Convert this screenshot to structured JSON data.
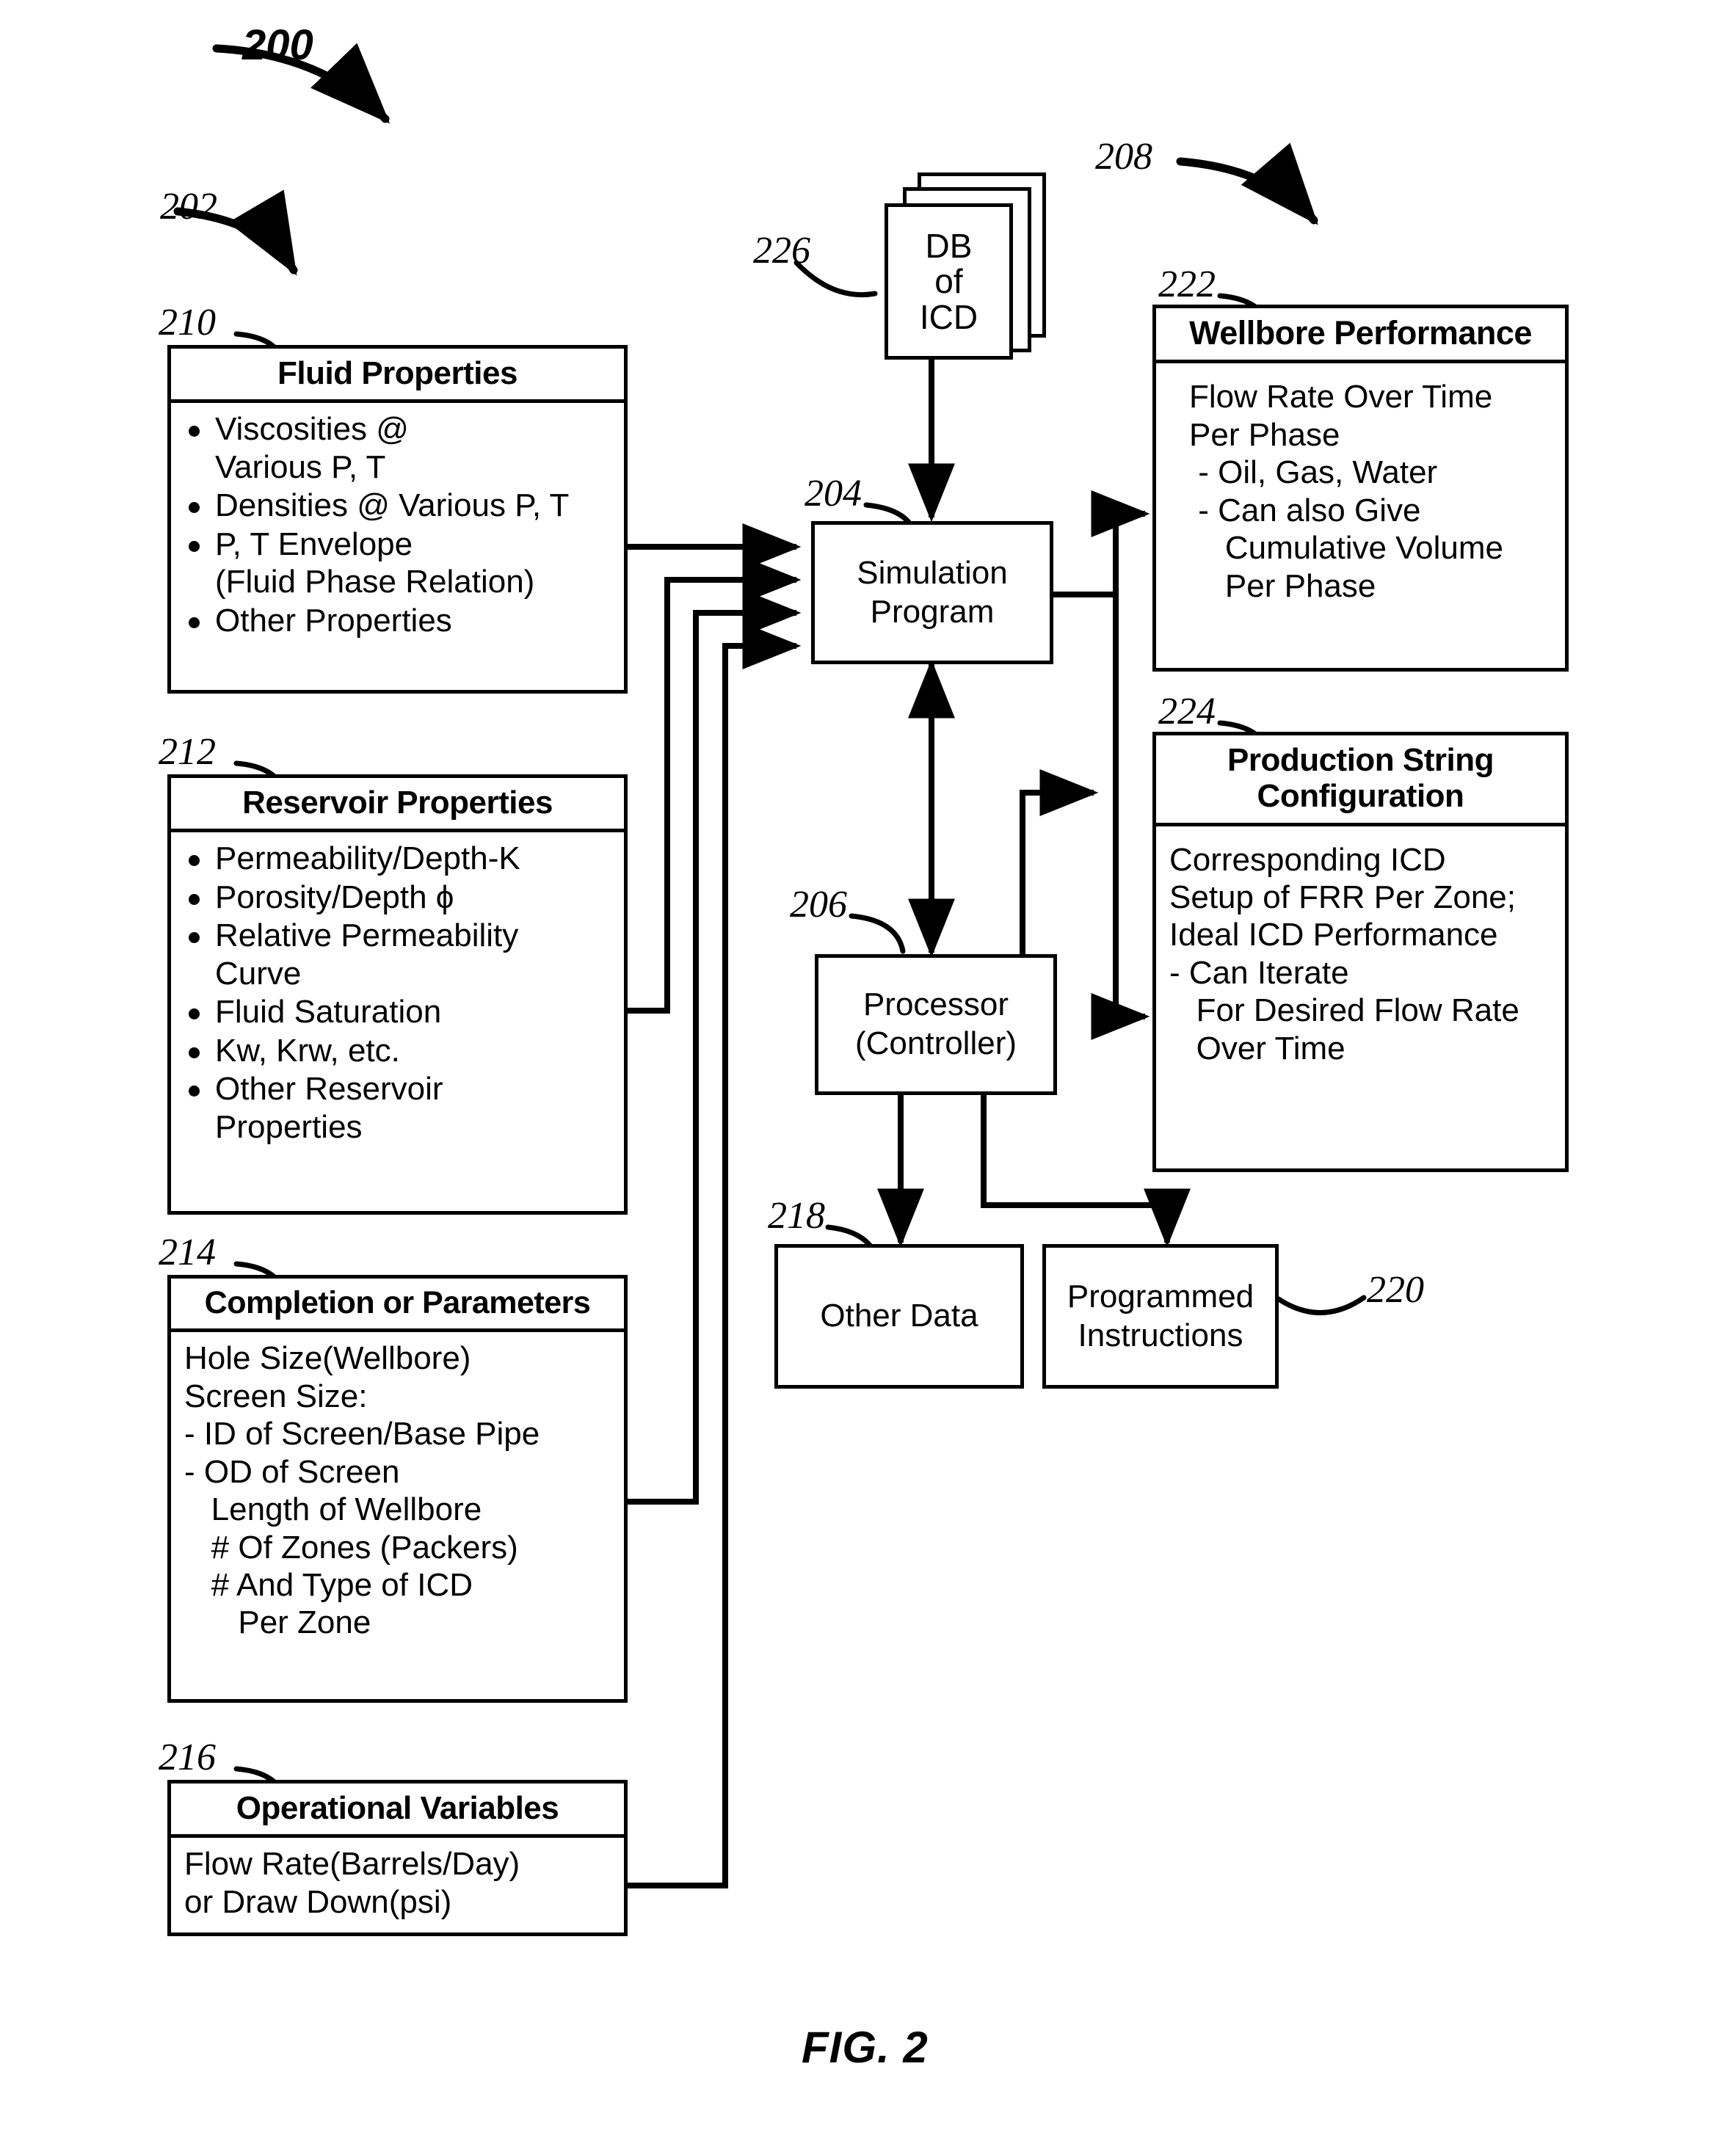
{
  "figure": {
    "caption": "FIG. 2",
    "system_ref": "200",
    "inputs_group_ref": "202",
    "outputs_group_ref": "208"
  },
  "boxes": {
    "fluid_properties": {
      "ref": "210",
      "title": "Fluid Properties",
      "bullets": [
        "Viscosities @\nVarious P, T",
        "Densities @ Various P, T",
        "P, T Envelope\n (Fluid Phase Relation)",
        "Other Properties"
      ]
    },
    "reservoir_properties": {
      "ref": "212",
      "title": "Reservoir Properties",
      "bullets": [
        "Permeability/Depth-K",
        "Porosity/Depth ϕ",
        "Relative Permeability\nCurve",
        "Fluid Saturation",
        "Kw, Krw, etc.",
        "Other Reservoir\nProperties"
      ]
    },
    "completion_parameters": {
      "ref": "214",
      "title": "Completion or Parameters",
      "lines": [
        "Hole Size(Wellbore)",
        "Screen Size:",
        "- ID of Screen/Base Pipe",
        "- OD of Screen",
        "   Length of Wellbore",
        "   # Of Zones (Packers)",
        "   # And Type of ICD",
        "      Per Zone"
      ]
    },
    "operational_variables": {
      "ref": "216",
      "title": "Operational Variables",
      "lines": [
        "Flow Rate(Barrels/Day)",
        "or Draw Down(psi)"
      ]
    },
    "db_of_icd": {
      "ref": "226",
      "label": "DB\nof\nICD"
    },
    "simulation_program": {
      "ref": "204",
      "label": "Simulation\nProgram"
    },
    "processor": {
      "ref": "206",
      "label": "Processor\n(Controller)"
    },
    "other_data": {
      "ref": "218",
      "label": "Other Data"
    },
    "programmed_instructions": {
      "ref": "220",
      "label": "Programmed\nInstructions"
    },
    "wellbore_performance": {
      "ref": "222",
      "title": "Wellbore Performance",
      "lines": [
        "Flow Rate Over Time",
        "Per Phase",
        " - Oil, Gas, Water",
        " - Can also Give",
        "    Cumulative Volume",
        "    Per Phase"
      ]
    },
    "production_string_configuration": {
      "ref": "224",
      "title": "Production String\nConfiguration",
      "lines": [
        "Corresponding ICD",
        "Setup of FRR Per Zone;",
        "Ideal ICD Performance",
        "- Can Iterate",
        "   For Desired Flow Rate",
        "   Over Time"
      ]
    }
  },
  "colors": {
    "stroke": "#000000",
    "background": "#ffffff"
  }
}
